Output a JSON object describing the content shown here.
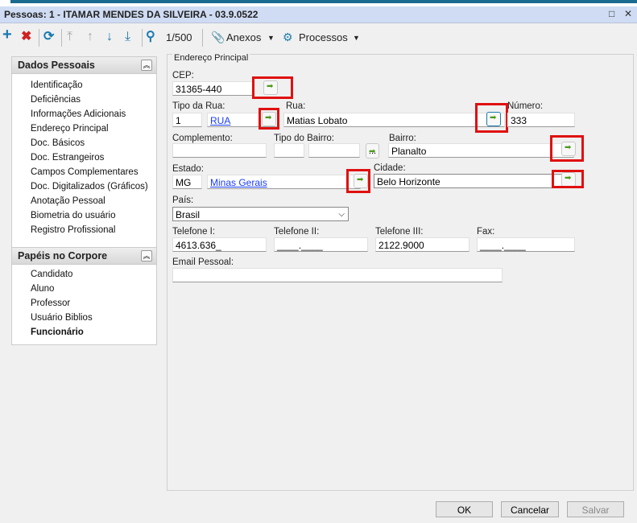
{
  "window": {
    "title": "Pessoas: 1 - ITAMAR MENDES DA SILVEIRA - 03.9.0522",
    "maximize": "□",
    "close": "✕"
  },
  "toolbar": {
    "record_counter": "1/500",
    "anexos": "Anexos",
    "processos": "Processos",
    "icons": [
      "plus-icon",
      "delete-icon",
      "refresh-icon",
      "first-icon",
      "previous-icon",
      "next-icon",
      "last-icon",
      "search-icon",
      "paperclip-icon",
      "gear-icon"
    ]
  },
  "sidebar": {
    "section1": {
      "title": "Dados Pessoais",
      "items": [
        "Identificação",
        "Deficiências",
        "Informações Adicionais",
        "Endereço Principal",
        "Doc. Básicos",
        "Doc. Estrangeiros",
        "Campos Complementares",
        "Doc. Digitalizados (Gráficos)",
        "Anotação Pessoal",
        "Biometria do usuário",
        "Registro Profissional"
      ]
    },
    "section2": {
      "title": "Papéis no Corpore",
      "items": [
        "Candidato",
        "Aluno",
        "Professor",
        "Usuário Biblios",
        "Funcionário"
      ]
    }
  },
  "form": {
    "group_title": "Endereço Principal",
    "cep": {
      "label": "CEP:",
      "value": "31365-440"
    },
    "tipo_rua": {
      "label": "Tipo da Rua:",
      "code": "1",
      "name": "RUA"
    },
    "rua": {
      "label": "Rua:",
      "value": "Matias Lobato"
    },
    "numero": {
      "label": "Número:",
      "value": "333"
    },
    "complemento": {
      "label": "Complemento:",
      "value": ""
    },
    "tipo_bairro": {
      "label": "Tipo do Bairro:",
      "code": "",
      "name": "",
      "browse": "..."
    },
    "bairro": {
      "label": "Bairro:",
      "value": "Planalto"
    },
    "estado": {
      "label": "Estado:",
      "code": "MG",
      "name": "Minas Gerais"
    },
    "cidade": {
      "label": "Cidade:",
      "value": "Belo Horizonte"
    },
    "pais": {
      "label": "País:",
      "value": "Brasil"
    },
    "telefone1": {
      "label": "Telefone I:",
      "value": "4613.636_"
    },
    "telefone2": {
      "label": "Telefone II:",
      "value": "____.____"
    },
    "telefone3": {
      "label": "Telefone III:",
      "value": "2122.9000"
    },
    "fax": {
      "label": "Fax:",
      "value": "____.____"
    },
    "email": {
      "label": "Email Pessoal:",
      "value": ""
    }
  },
  "buttons": {
    "ok": "OK",
    "cancel": "Cancelar",
    "save": "Salvar"
  },
  "colors": {
    "highlight": "#e01010",
    "accent": "#1a7ab0",
    "link": "#1a3cff"
  }
}
